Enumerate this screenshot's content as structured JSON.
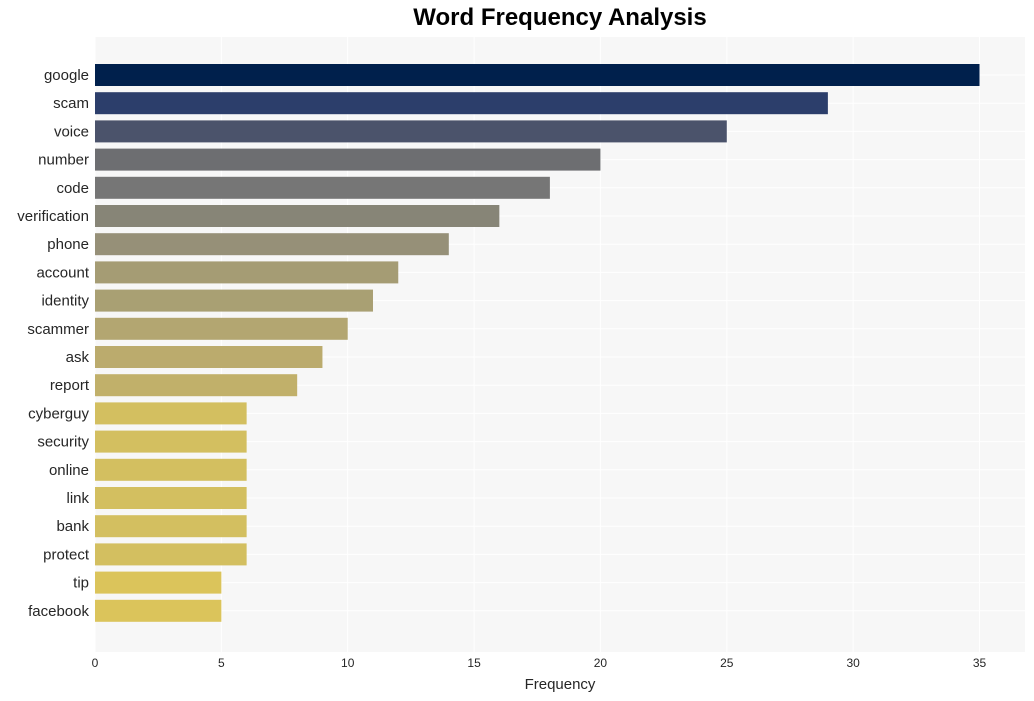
{
  "chart_data": {
    "type": "bar",
    "orientation": "horizontal",
    "title": "Word Frequency Analysis",
    "xlabel": "Frequency",
    "ylabel": "",
    "xlim": [
      0,
      36.8
    ],
    "xticks": [
      0,
      5,
      10,
      15,
      20,
      25,
      30,
      35
    ],
    "grid": true,
    "categories": [
      "google",
      "scam",
      "voice",
      "number",
      "code",
      "verification",
      "phone",
      "account",
      "identity",
      "scammer",
      "ask",
      "report",
      "cyberguy",
      "security",
      "online",
      "link",
      "bank",
      "protect",
      "tip",
      "facebook"
    ],
    "values": [
      35,
      29,
      25,
      20,
      18,
      16,
      14,
      12,
      11,
      10,
      9,
      8,
      6,
      6,
      6,
      6,
      6,
      6,
      5,
      5
    ],
    "colors": [
      "#00204c",
      "#2c3e6b",
      "#4b536b",
      "#6d6e71",
      "#767676",
      "#878577",
      "#969078",
      "#a59c74",
      "#a9a073",
      "#b3a671",
      "#bbab6d",
      "#c1b06a",
      "#d3bf60",
      "#d3bf60",
      "#d3bf60",
      "#d3bf60",
      "#d3bf60",
      "#d3bf60",
      "#dbc45b",
      "#dbc45b"
    ]
  }
}
